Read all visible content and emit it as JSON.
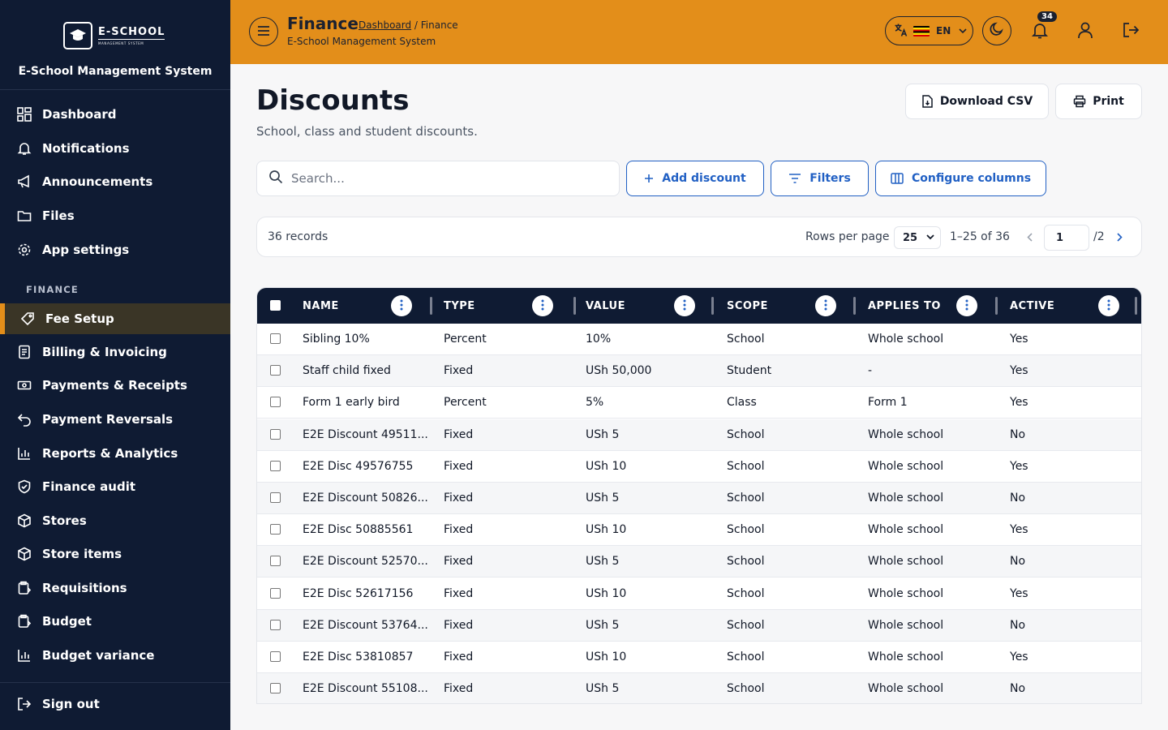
{
  "sidebar": {
    "logo_main": "E-SCHOOL",
    "logo_sub": "MANAGEMENT SYSTEM",
    "system_name": "E-School Management System",
    "items": [
      {
        "label": "Dashboard",
        "icon": "grid-icon"
      },
      {
        "label": "Notifications",
        "icon": "bell-icon"
      },
      {
        "label": "Announcements",
        "icon": "megaphone-icon"
      },
      {
        "label": "Files",
        "icon": "folder-icon"
      },
      {
        "label": "App settings",
        "icon": "gear-icon"
      }
    ],
    "section_finance": "FINANCE",
    "finance_items": [
      {
        "label": "Fee Setup",
        "icon": "tag-icon",
        "active": true
      },
      {
        "label": "Billing & Invoicing",
        "icon": "document-icon"
      },
      {
        "label": "Payments & Receipts",
        "icon": "cash-icon"
      },
      {
        "label": "Payment Reversals",
        "icon": "undo-icon"
      },
      {
        "label": "Reports & Analytics",
        "icon": "bar-chart-icon"
      },
      {
        "label": "Finance audit",
        "icon": "shield-icon"
      },
      {
        "label": "Stores",
        "icon": "box-icon"
      },
      {
        "label": "Store items",
        "icon": "box-icon"
      },
      {
        "label": "Requisitions",
        "icon": "clipboard-icon"
      },
      {
        "label": "Budget",
        "icon": "clipboard-icon"
      },
      {
        "label": "Budget variance",
        "icon": "bar-chart-icon"
      }
    ],
    "sign_out": "Sign out"
  },
  "header": {
    "title": "Finance",
    "breadcrumb_link": "Dashboard",
    "breadcrumb_sep": " / ",
    "breadcrumb_current": "Finance",
    "subtitle": "E-School Management System",
    "language": "EN",
    "notification_count": "34"
  },
  "page": {
    "title": "Discounts",
    "subtitle": "School, class and student discounts.",
    "download_csv": "Download CSV",
    "print": "Print",
    "search_placeholder": "Search...",
    "add_discount": "Add discount",
    "filters": "Filters",
    "configure_columns": "Configure columns"
  },
  "pagination": {
    "records": "36 records",
    "rows_per_page_label": "Rows per page",
    "rows_per_page": "25",
    "range": "1–25 of 36",
    "current_page": "1",
    "total_pages": "/2"
  },
  "table": {
    "columns": [
      "NAME",
      "TYPE",
      "VALUE",
      "SCOPE",
      "APPLIES TO",
      "ACTIVE"
    ],
    "rows": [
      [
        "Sibling 10%",
        "Percent",
        "10%",
        "School",
        "Whole school",
        "Yes"
      ],
      [
        "Staff child fixed",
        "Fixed",
        "USh 50,000",
        "Student",
        "-",
        "Yes"
      ],
      [
        "Form 1 early bird",
        "Percent",
        "5%",
        "Class",
        "Form 1",
        "Yes"
      ],
      [
        "E2E Discount 49511...",
        "Fixed",
        "USh 5",
        "School",
        "Whole school",
        "No"
      ],
      [
        "E2E Disc 49576755",
        "Fixed",
        "USh 10",
        "School",
        "Whole school",
        "Yes"
      ],
      [
        "E2E Discount 50826...",
        "Fixed",
        "USh 5",
        "School",
        "Whole school",
        "No"
      ],
      [
        "E2E Disc 50885561",
        "Fixed",
        "USh 10",
        "School",
        "Whole school",
        "Yes"
      ],
      [
        "E2E Discount 52570...",
        "Fixed",
        "USh 5",
        "School",
        "Whole school",
        "No"
      ],
      [
        "E2E Disc 52617156",
        "Fixed",
        "USh 10",
        "School",
        "Whole school",
        "Yes"
      ],
      [
        "E2E Discount 53764...",
        "Fixed",
        "USh 5",
        "School",
        "Whole school",
        "No"
      ],
      [
        "E2E Disc 53810857",
        "Fixed",
        "USh 10",
        "School",
        "Whole school",
        "Yes"
      ],
      [
        "E2E Discount 55108...",
        "Fixed",
        "USh 5",
        "School",
        "Whole school",
        "No"
      ]
    ]
  }
}
